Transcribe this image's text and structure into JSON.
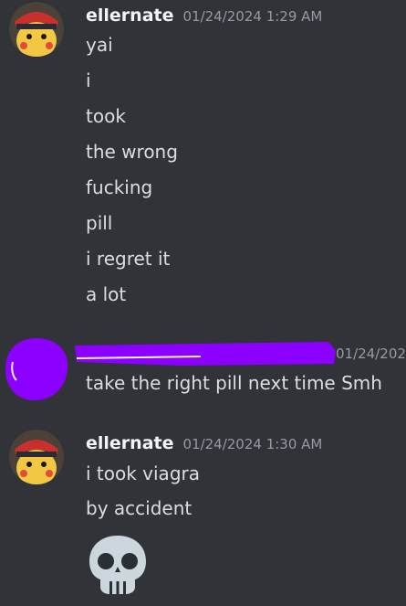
{
  "messages": [
    {
      "username": "ellernate",
      "timestamp": "01/24/2024 1:29 AM",
      "lines": [
        "yai",
        "i",
        "took",
        "the wrong",
        "fucking",
        "pill",
        "i regret it",
        "a lot"
      ]
    },
    {
      "username": "",
      "timestamp": "01/24/202",
      "lines": [
        "take the right pill next time Smh"
      ]
    },
    {
      "username": "ellernate",
      "timestamp": "01/24/2024 1:30 AM",
      "lines": [
        "i took viagra",
        "by accident"
      ],
      "emoji": "skull-emoji"
    }
  ],
  "colors": {
    "background": "#313338",
    "username": "#f2f3f5",
    "timestamp": "#949ba4",
    "text": "#dbdee1",
    "redaction": "#8b00ff"
  }
}
